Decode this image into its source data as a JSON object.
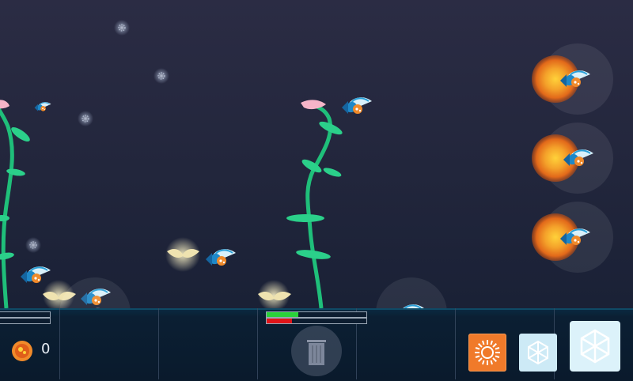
{
  "hud": {
    "coins": "0",
    "sun_button": "sun-power",
    "freeze_button": "freeze-power",
    "freeze_big_button": "freeze-all-power",
    "trash_button": "trash"
  },
  "plants": [
    {
      "name": "left-vine",
      "health": 0.0
    },
    {
      "name": "center-vine",
      "health": 0.32,
      "damage": 0.25
    }
  ],
  "colors": {
    "vine": "#1fbf7a",
    "leaf": "#2bd08a",
    "fire": "#f08a2a",
    "ice": "#cdeaf6",
    "bird_blue": "#1e88c8",
    "bird_orange": "#f08a2a",
    "bar_green": "#2ad13a",
    "bar_red": "#e0151a"
  }
}
